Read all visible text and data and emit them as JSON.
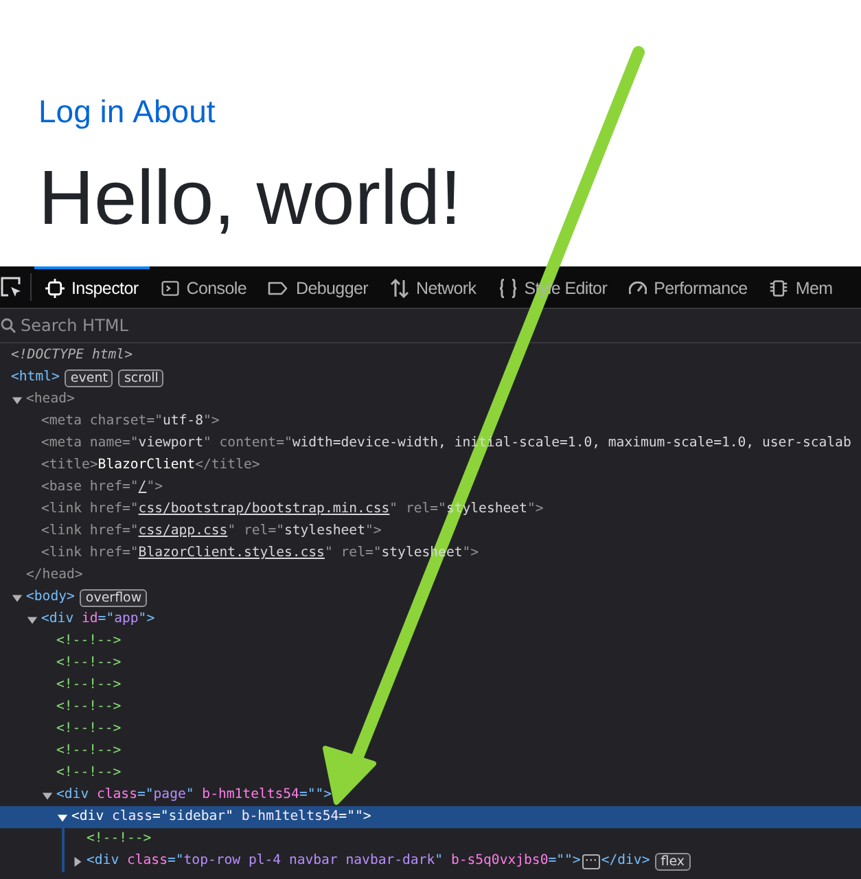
{
  "page": {
    "links": [
      {
        "label": "Log in"
      },
      {
        "label": "About"
      }
    ],
    "heading": "Hello, world!"
  },
  "toolbar": {
    "tabs": [
      {
        "label": "Inspector",
        "selected": true
      },
      {
        "label": "Console",
        "selected": false
      },
      {
        "label": "Debugger",
        "selected": false
      },
      {
        "label": "Network",
        "selected": false
      },
      {
        "label": "Style Editor",
        "selected": false
      },
      {
        "label": "Performance",
        "selected": false
      },
      {
        "label": "Mem",
        "selected": false
      }
    ]
  },
  "search": {
    "placeholder": "Search HTML"
  },
  "tree": [
    {
      "tokens": [
        {
          "kind": "doctype",
          "text": "<!DOCTYPE html>"
        }
      ],
      "selected": false
    },
    {
      "tokens": [
        {
          "kind": "tag",
          "text": "<html>"
        }
      ],
      "badges": [
        "event",
        "scroll"
      ],
      "selected": false
    },
    {
      "tokens": [
        {
          "kind": "tag",
          "text": "<head>"
        }
      ],
      "dimmed": true,
      "expanded": true,
      "selected": false,
      "closing": "</head>",
      "children": [
        {
          "tokens": [
            {
              "kind": "tag",
              "text": "<meta"
            },
            {
              "kind": "attr",
              "text": " charset"
            },
            {
              "kind": "tag",
              "text": "=\""
            },
            {
              "kind": "value",
              "text": "utf-8"
            },
            {
              "kind": "tag",
              "text": "\">"
            }
          ],
          "dimmed": true,
          "selected": false
        },
        {
          "tokens": [
            {
              "kind": "tag",
              "text": "<meta"
            },
            {
              "kind": "attr",
              "text": " name"
            },
            {
              "kind": "tag",
              "text": "=\""
            },
            {
              "kind": "value",
              "text": "viewport"
            },
            {
              "kind": "tag",
              "text": "\""
            },
            {
              "kind": "attr",
              "text": " content"
            },
            {
              "kind": "tag",
              "text": "=\""
            },
            {
              "kind": "value",
              "text": "width=device-width, initial-scale=1.0, maximum-scale=1.0, user-scalab"
            }
          ],
          "dimmed": true,
          "selected": false
        },
        {
          "tokens": [
            {
              "kind": "tag",
              "text": "<title>"
            },
            {
              "kind": "text",
              "text": "BlazorClient"
            },
            {
              "kind": "tag",
              "text": "</title>"
            }
          ],
          "dimmed": true,
          "selected": false
        },
        {
          "tokens": [
            {
              "kind": "tag",
              "text": "<base"
            },
            {
              "kind": "attr",
              "text": " href"
            },
            {
              "kind": "tag",
              "text": "=\""
            },
            {
              "kind": "link",
              "text": "/"
            },
            {
              "kind": "tag",
              "text": "\">"
            }
          ],
          "dimmed": true,
          "selected": false
        },
        {
          "tokens": [
            {
              "kind": "tag",
              "text": "<link"
            },
            {
              "kind": "attr",
              "text": " href"
            },
            {
              "kind": "tag",
              "text": "=\""
            },
            {
              "kind": "link",
              "text": "css/bootstrap/bootstrap.min.css"
            },
            {
              "kind": "tag",
              "text": "\""
            },
            {
              "kind": "attr",
              "text": " rel"
            },
            {
              "kind": "tag",
              "text": "=\""
            },
            {
              "kind": "value",
              "text": "stylesheet"
            },
            {
              "kind": "tag",
              "text": "\">"
            }
          ],
          "dimmed": true,
          "selected": false
        },
        {
          "tokens": [
            {
              "kind": "tag",
              "text": "<link"
            },
            {
              "kind": "attr",
              "text": " href"
            },
            {
              "kind": "tag",
              "text": "=\""
            },
            {
              "kind": "link",
              "text": "css/app.css"
            },
            {
              "kind": "tag",
              "text": "\""
            },
            {
              "kind": "attr",
              "text": " rel"
            },
            {
              "kind": "tag",
              "text": "=\""
            },
            {
              "kind": "value",
              "text": "stylesheet"
            },
            {
              "kind": "tag",
              "text": "\">"
            }
          ],
          "dimmed": true,
          "selected": false
        },
        {
          "tokens": [
            {
              "kind": "tag",
              "text": "<link"
            },
            {
              "kind": "attr",
              "text": " href"
            },
            {
              "kind": "tag",
              "text": "=\""
            },
            {
              "kind": "link",
              "text": "BlazorClient.styles.css"
            },
            {
              "kind": "tag",
              "text": "\""
            },
            {
              "kind": "attr",
              "text": " rel"
            },
            {
              "kind": "tag",
              "text": "=\""
            },
            {
              "kind": "value",
              "text": "stylesheet"
            },
            {
              "kind": "tag",
              "text": "\">"
            }
          ],
          "dimmed": true,
          "selected": false
        }
      ]
    },
    {
      "tokens": [
        {
          "kind": "tag",
          "text": "<body>"
        }
      ],
      "badges": [
        "overflow"
      ],
      "expanded": true,
      "selected": false,
      "children": [
        {
          "tokens": [
            {
              "kind": "tag",
              "text": "<div"
            },
            {
              "kind": "attr",
              "text": " id"
            },
            {
              "kind": "tag",
              "text": "=\""
            },
            {
              "kind": "value",
              "text": "app"
            },
            {
              "kind": "tag",
              "text": "\">"
            }
          ],
          "expanded": true,
          "selected": false,
          "children": [
            {
              "tokens": [
                {
                  "kind": "comment",
                  "text": "<!--!-->"
                }
              ],
              "selected": false
            },
            {
              "tokens": [
                {
                  "kind": "comment",
                  "text": "<!--!-->"
                }
              ],
              "selected": false
            },
            {
              "tokens": [
                {
                  "kind": "comment",
                  "text": "<!--!-->"
                }
              ],
              "selected": false
            },
            {
              "tokens": [
                {
                  "kind": "comment",
                  "text": "<!--!-->"
                }
              ],
              "selected": false
            },
            {
              "tokens": [
                {
                  "kind": "comment",
                  "text": "<!--!-->"
                }
              ],
              "selected": false
            },
            {
              "tokens": [
                {
                  "kind": "comment",
                  "text": "<!--!-->"
                }
              ],
              "selected": false
            },
            {
              "tokens": [
                {
                  "kind": "comment",
                  "text": "<!--!-->"
                }
              ],
              "selected": false
            },
            {
              "tokens": [
                {
                  "kind": "tag",
                  "text": "<div"
                },
                {
                  "kind": "attr",
                  "text": " class"
                },
                {
                  "kind": "tag",
                  "text": "=\""
                },
                {
                  "kind": "value",
                  "text": "page"
                },
                {
                  "kind": "tag",
                  "text": "\""
                },
                {
                  "kind": "attr",
                  "text": " b-hm1telts54"
                },
                {
                  "kind": "tag",
                  "text": "=\"\">"
                }
              ],
              "expanded": true,
              "selected": false,
              "children": [
                {
                  "tokens": [
                    {
                      "kind": "tag",
                      "text": "<div"
                    },
                    {
                      "kind": "attr",
                      "text": " class"
                    },
                    {
                      "kind": "tag",
                      "text": "=\""
                    },
                    {
                      "kind": "value",
                      "text": "sidebar"
                    },
                    {
                      "kind": "tag",
                      "text": "\""
                    },
                    {
                      "kind": "attr",
                      "text": " b-hm1telts54"
                    },
                    {
                      "kind": "tag",
                      "text": "=\"\">"
                    }
                  ],
                  "expanded": true,
                  "selected": true,
                  "children": [
                    {
                      "tokens": [
                        {
                          "kind": "comment",
                          "text": "<!--!-->"
                        }
                      ],
                      "selected": false
                    },
                    {
                      "tokens": [
                        {
                          "kind": "tag",
                          "text": "<div"
                        },
                        {
                          "kind": "attr",
                          "text": " class"
                        },
                        {
                          "kind": "tag",
                          "text": "=\""
                        },
                        {
                          "kind": "value",
                          "text": "top-row pl-4 navbar navbar-dark"
                        },
                        {
                          "kind": "tag",
                          "text": "\""
                        },
                        {
                          "kind": "attr",
                          "text": " b-s5q0vxjbs0"
                        },
                        {
                          "kind": "tag",
                          "text": "=\"\">"
                        },
                        {
                          "kind": "more",
                          "text": "⋯"
                        },
                        {
                          "kind": "tag",
                          "text": "</div>"
                        }
                      ],
                      "badges": [
                        "flex"
                      ],
                      "expanded": false,
                      "selected": false
                    }
                  ]
                }
              ]
            }
          ]
        }
      ]
    }
  ]
}
